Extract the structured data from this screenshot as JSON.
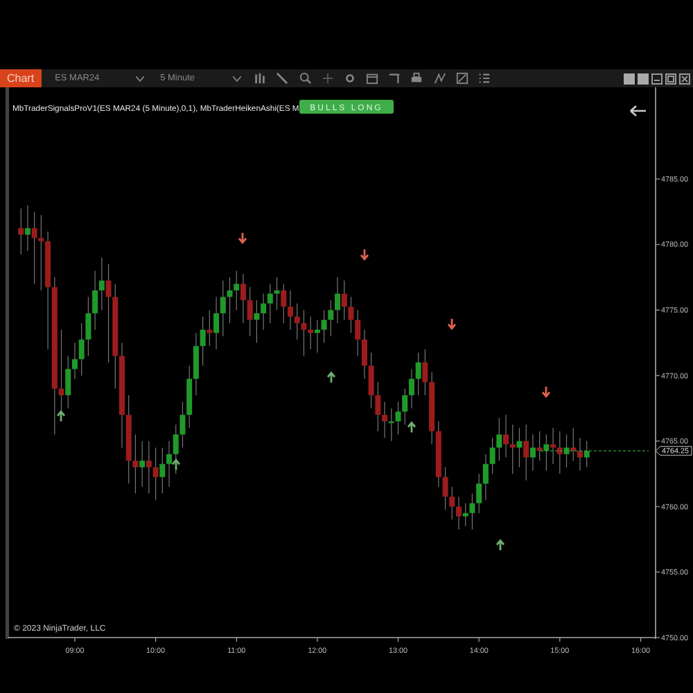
{
  "toolbar": {
    "title": "Chart",
    "instrument": "ES MAR24",
    "interval": "5 Minute"
  },
  "indicator_label": "MbTraderSignalsProV1(ES MAR24 (5 Minute),0,1), MbTraderHeikenAshi(ES M",
  "signal_badge": "BULLS LONG",
  "chart": {
    "chart_data": {
      "type": "candlestick",
      "categories": [
        null,
        null,
        null,
        null,
        null,
        null,
        null,
        null,
        "09:00",
        null,
        null,
        null,
        null,
        null,
        null,
        null,
        null,
        null,
        null,
        null,
        "10:00",
        null,
        null,
        null,
        null,
        null,
        null,
        null,
        null,
        null,
        null,
        null,
        "11:00",
        null,
        null,
        null,
        null,
        null,
        null,
        null,
        null,
        null,
        null,
        null,
        "12:00",
        null,
        null,
        null,
        null,
        null,
        null,
        null,
        null,
        null,
        null,
        null,
        "13:00",
        null,
        null,
        null,
        null,
        null,
        null,
        null,
        null,
        null,
        null,
        null,
        "14:00",
        null,
        null,
        null,
        null,
        null,
        null,
        null,
        null,
        null,
        null,
        null,
        "15:00",
        null,
        null,
        null,
        null,
        null,
        null,
        null,
        null,
        null,
        null,
        null,
        "16:00"
      ],
      "ohlc": [
        [
          4781.25,
          4782.75,
          4779.25,
          4780.75
        ],
        [
          4780.75,
          4783,
          4779.5,
          4781.25
        ],
        [
          4781.25,
          4782.5,
          4777,
          4780.5
        ],
        [
          4780.5,
          4782.25,
          4776.5,
          4780.25
        ],
        [
          4780.25,
          4781,
          4772,
          4776.75
        ],
        [
          4776.75,
          4777.5,
          4765.5,
          4769
        ],
        [
          4769,
          4773.5,
          4767,
          4768.5
        ],
        [
          4768.5,
          4771.5,
          4767.5,
          4770.5
        ],
        [
          4770.5,
          4772.5,
          4769.75,
          4771.25
        ],
        [
          4771.25,
          4774,
          4770,
          4772.75
        ],
        [
          4772.75,
          4776,
          4771.5,
          4774.75
        ],
        [
          4774.75,
          4778,
          4773.5,
          4776.5
        ],
        [
          4776.5,
          4779,
          4775,
          4777.25
        ],
        [
          4777.25,
          4778.5,
          4771,
          4776
        ],
        [
          4776,
          4777,
          4769,
          4771.5
        ],
        [
          4771.5,
          4772.5,
          4764.5,
          4767
        ],
        [
          4767,
          4768.5,
          4761.75,
          4763.5
        ],
        [
          4763.5,
          4765.5,
          4761,
          4763
        ],
        [
          4763,
          4765,
          4761.5,
          4763.5
        ],
        [
          4763.5,
          4765,
          4761,
          4763
        ],
        [
          4763,
          4764.5,
          4760.5,
          4762.25
        ],
        [
          4762.25,
          4764.5,
          4761,
          4763.25
        ],
        [
          4763.25,
          4765,
          4761.5,
          4764
        ],
        [
          4764,
          4766.25,
          4762.5,
          4765.5
        ],
        [
          4765.5,
          4768,
          4764.5,
          4767
        ],
        [
          4767,
          4770.75,
          4766,
          4769.75
        ],
        [
          4769.75,
          4773.25,
          4768.5,
          4772.25
        ],
        [
          4772.25,
          4774.5,
          4770.75,
          4773.5
        ],
        [
          4773.5,
          4775,
          4772.25,
          4773.25
        ],
        [
          4773.25,
          4776,
          4772,
          4774.75
        ],
        [
          4774.75,
          4777.25,
          4773,
          4776
        ],
        [
          4776,
          4777.5,
          4774,
          4776.5
        ],
        [
          4776.5,
          4778,
          4775,
          4777
        ],
        [
          4777,
          4777.75,
          4774,
          4775.75
        ],
        [
          4775.75,
          4776.75,
          4773,
          4774.25
        ],
        [
          4774.25,
          4775.75,
          4772.5,
          4774.75
        ],
        [
          4774.75,
          4776.25,
          4773.5,
          4775.5
        ],
        [
          4775.5,
          4777,
          4774,
          4776.25
        ],
        [
          4776.25,
          4777.5,
          4775,
          4776.5
        ],
        [
          4776.5,
          4777,
          4774,
          4775.25
        ],
        [
          4775.25,
          4776.5,
          4773.5,
          4774.5
        ],
        [
          4774.5,
          4775.5,
          4772.75,
          4774
        ],
        [
          4774,
          4775,
          4771.5,
          4773.5
        ],
        [
          4773.5,
          4774.5,
          4772,
          4773.25
        ],
        [
          4773.25,
          4774.25,
          4771.75,
          4773.5
        ],
        [
          4773.5,
          4775,
          4772.5,
          4774.25
        ],
        [
          4774.25,
          4775.75,
          4773,
          4775
        ],
        [
          4775,
          4777.5,
          4774,
          4776.25
        ],
        [
          4776.25,
          4777.25,
          4774.25,
          4775.25
        ],
        [
          4775.25,
          4776,
          4773.25,
          4774.25
        ],
        [
          4774.25,
          4775,
          4771.5,
          4772.75
        ],
        [
          4772.75,
          4773.5,
          4769.75,
          4770.75
        ],
        [
          4770.75,
          4771.75,
          4767.5,
          4768.5
        ],
        [
          4768.5,
          4769.5,
          4765.75,
          4767
        ],
        [
          4767,
          4768,
          4765.25,
          4766.5
        ],
        [
          4766.5,
          4767.5,
          4765,
          4766.5
        ],
        [
          4766.5,
          4768,
          4765.5,
          4767.25
        ],
        [
          4767.25,
          4769,
          4766.25,
          4768.5
        ],
        [
          4768.5,
          4770.5,
          4767.5,
          4769.75
        ],
        [
          4769.75,
          4771.75,
          4768.5,
          4771
        ],
        [
          4771,
          4772,
          4768.5,
          4769.5
        ],
        [
          4769.5,
          4770.25,
          4764.75,
          4765.75
        ],
        [
          4765.75,
          4766.5,
          4761.5,
          4762.25
        ],
        [
          4762.25,
          4763,
          4759.75,
          4760.75
        ],
        [
          4760.75,
          4761.5,
          4759,
          4760
        ],
        [
          4760,
          4760.75,
          4758.25,
          4759.25
        ],
        [
          4759.25,
          4760.25,
          4758.5,
          4759.5
        ],
        [
          4759.5,
          4761,
          4758.25,
          4760.25
        ],
        [
          4760.25,
          4762.5,
          4759.5,
          4761.75
        ],
        [
          4761.75,
          4764,
          4760.5,
          4763.25
        ],
        [
          4763.25,
          4765.25,
          4762.5,
          4764.5
        ],
        [
          4764.5,
          4766.75,
          4763.5,
          4765.5
        ],
        [
          4765.5,
          4767,
          4763.75,
          4764.75
        ],
        [
          4764.75,
          4766.25,
          4762.5,
          4764.5
        ],
        [
          4764.5,
          4766,
          4763,
          4765
        ],
        [
          4765,
          4766.25,
          4762,
          4763.75
        ],
        [
          4763.75,
          4765.5,
          4762.75,
          4764.5
        ],
        [
          4764.5,
          4765.75,
          4763.5,
          4764.25
        ],
        [
          4764.25,
          4765.5,
          4762.75,
          4764.75
        ],
        [
          4764.75,
          4766,
          4763.25,
          4764.5
        ],
        [
          4764.5,
          4765.75,
          4762.5,
          4764
        ],
        [
          4764,
          4765.5,
          4763,
          4764.5
        ],
        [
          4764.5,
          4766,
          4763.5,
          4764.25
        ],
        [
          4764.25,
          4765.25,
          4762.75,
          4763.75
        ],
        [
          4763.75,
          4765,
          4763,
          4764.25
        ],
        null,
        null,
        null,
        null,
        null,
        null,
        null,
        null
      ],
      "ylim": [
        4750,
        4792
      ],
      "ref_lines": [
        {
          "axis": "y",
          "value": 4764.25,
          "label": "4764.25"
        }
      ],
      "yticks": [
        {
          "value": 4785,
          "label": "4785.00"
        },
        {
          "value": 4780,
          "label": "4780.00"
        },
        {
          "value": 4775,
          "label": "4775.00"
        },
        {
          "value": 4770,
          "label": "4770.00"
        },
        {
          "value": 4765,
          "label": "4765.00"
        },
        {
          "value": 4760,
          "label": "4760.00"
        },
        {
          "value": 4755,
          "label": "4755.00"
        },
        {
          "value": 4750,
          "label": "4750.00"
        }
      ]
    }
  },
  "copyright": "© 2023 NinjaTrader, LLC"
}
